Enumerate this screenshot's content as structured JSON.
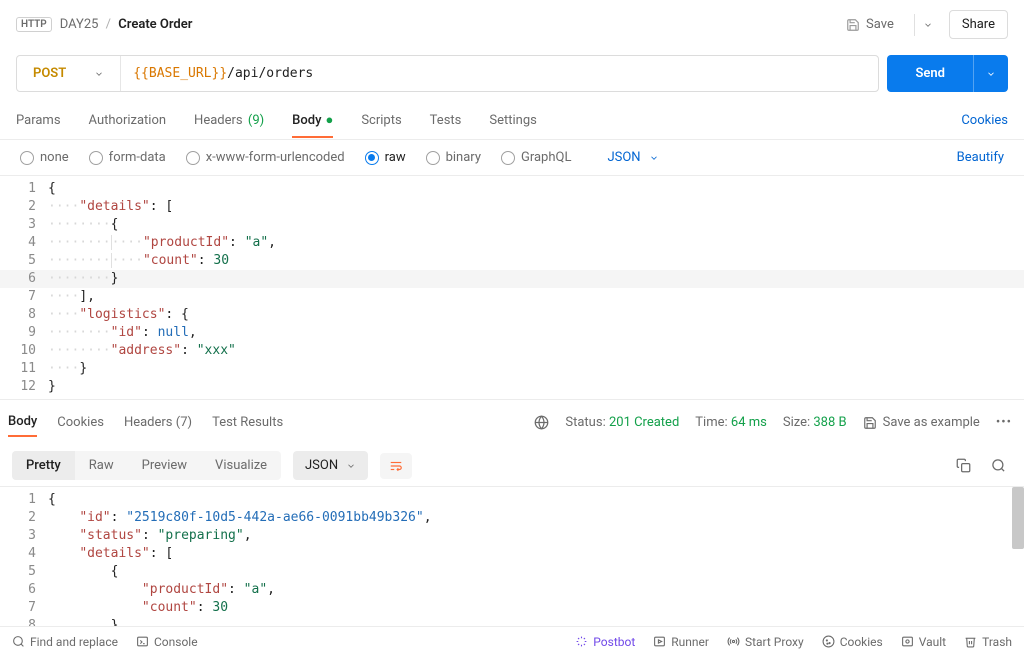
{
  "breadcrumb": {
    "collection": "DAY25",
    "current": "Create Order"
  },
  "header": {
    "save": "Save",
    "share": "Share"
  },
  "request": {
    "method": "POST",
    "url_var": "{{BASE_URL}}",
    "url_path": "/api/orders",
    "send": "Send"
  },
  "req_tabs": {
    "params": "Params",
    "auth": "Authorization",
    "headers": "Headers",
    "headers_count": "(9)",
    "body": "Body",
    "scripts": "Scripts",
    "tests": "Tests",
    "settings": "Settings",
    "cookies": "Cookies"
  },
  "body_types": {
    "none": "none",
    "formdata": "form-data",
    "xwww": "x-www-form-urlencoded",
    "raw": "raw",
    "binary": "binary",
    "graphql": "GraphQL",
    "json": "JSON",
    "beautify": "Beautify"
  },
  "req_body_lines": [
    "{",
    "····\"details\": [",
    "········{",
    "············\"productId\": \"a\",",
    "············\"count\": 30",
    "········}",
    "····],",
    "····\"logistics\": {",
    "········\"id\": null,",
    "········\"address\": \"xxx\"",
    "····}",
    "}"
  ],
  "resp_tabs": {
    "body": "Body",
    "cookies": "Cookies",
    "headers": "Headers",
    "headers_count": "(7)",
    "tests": "Test Results"
  },
  "resp_meta": {
    "status_label": "Status:",
    "status_value": "201 Created",
    "time_label": "Time:",
    "time_value": "64 ms",
    "size_label": "Size:",
    "size_value": "388 B",
    "save_example": "Save as example"
  },
  "view": {
    "pretty": "Pretty",
    "raw": "Raw",
    "preview": "Preview",
    "visualize": "Visualize",
    "json": "JSON"
  },
  "resp_body": {
    "id": "2519c80f-10d5-442a-ae66-0091bb49b326",
    "status": "preparing",
    "details": [
      {
        "productId": "a",
        "count": 30
      }
    ]
  },
  "footer": {
    "find": "Find and replace",
    "console": "Console",
    "postbot": "Postbot",
    "runner": "Runner",
    "proxy": "Start Proxy",
    "cookies": "Cookies",
    "vault": "Vault",
    "trash": "Trash"
  }
}
